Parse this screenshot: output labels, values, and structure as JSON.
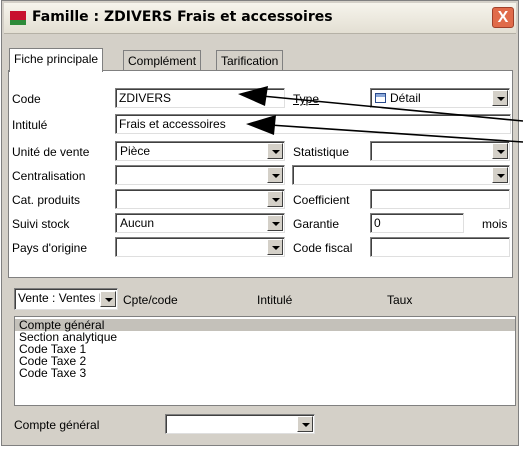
{
  "window": {
    "title": "Famille : ZDIVERS Frais et accessoires",
    "close_glyph": "X",
    "accent": "#c8102e"
  },
  "tabs": [
    {
      "label": "Fiche principale",
      "active": true
    },
    {
      "label": "Complément",
      "active": false
    },
    {
      "label": "Tarification",
      "active": false
    }
  ],
  "form": {
    "code": {
      "label": "Code",
      "value": "ZDIVERS"
    },
    "type": {
      "label": "Type",
      "value": "Détail",
      "icon": "grid-icon"
    },
    "intitule": {
      "label": "Intitulé",
      "value": "Frais et accessoires"
    },
    "unite_vente": {
      "label": "Unité de vente",
      "value": "Pièce"
    },
    "statistique": {
      "label": "Statistique",
      "value": ""
    },
    "centralisation": {
      "label": "Centralisation",
      "value": "",
      "right_value": ""
    },
    "cat_produits": {
      "label": "Cat. produits",
      "value": ""
    },
    "coefficient": {
      "label": "Coefficient",
      "value": ""
    },
    "suivi_stock": {
      "label": "Suivi stock",
      "value": "Aucun"
    },
    "garantie": {
      "label": "Garantie",
      "value": "0",
      "unit": "mois"
    },
    "pays_origine": {
      "label": "Pays d'origine",
      "value": ""
    },
    "code_fiscal": {
      "label": "Code fiscal",
      "value": ""
    }
  },
  "accounting": {
    "selector_value": "Vente : Ventes F...",
    "columns": [
      "Cpte/code",
      "Intitulé",
      "Taux"
    ],
    "items": [
      "Compte général",
      "Section analytique",
      "Code Taxe 1",
      "Code Taxe 2",
      "Code Taxe 3"
    ],
    "selected_index": 0,
    "bottom_label": "Compte général",
    "bottom_value": ""
  }
}
